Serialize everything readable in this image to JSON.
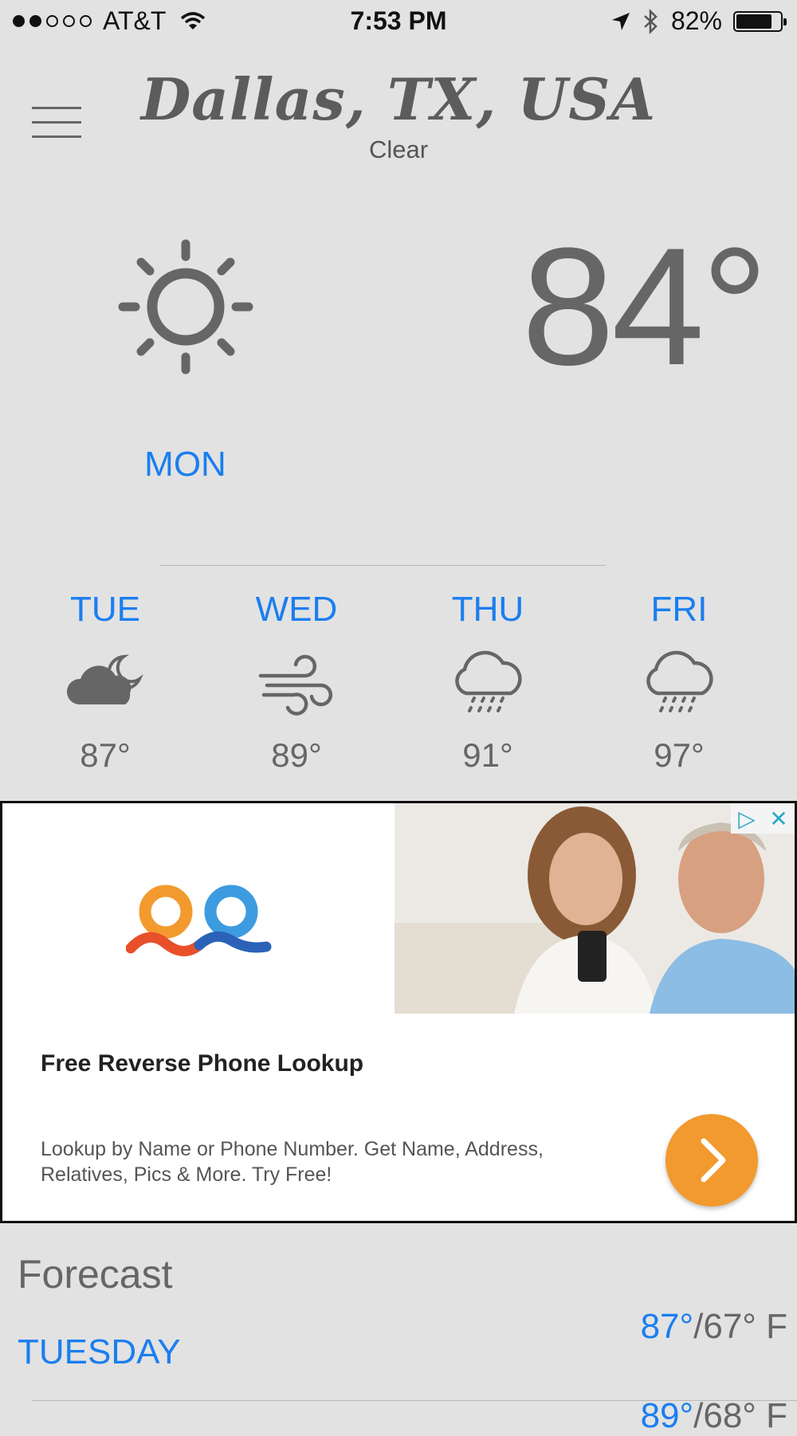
{
  "status_bar": {
    "signal_bars_filled": 2,
    "signal_bars_total": 5,
    "carrier": "AT&T",
    "time": "7:53 PM",
    "battery_text": "82%",
    "battery_level": 0.82,
    "icons": [
      "wifi-icon",
      "location-arrow-icon",
      "bluetooth-icon",
      "battery-icon"
    ]
  },
  "header": {
    "menu_icon": "hamburger-menu-icon",
    "location": "Dallas, TX, USA",
    "condition": "Clear"
  },
  "current": {
    "icon": "sun-icon",
    "temperature": "84°",
    "day": "MON"
  },
  "days": [
    {
      "name": "TUE",
      "icon": "cloudy-night-icon",
      "temp": "87°"
    },
    {
      "name": "WED",
      "icon": "wind-icon",
      "temp": "89°"
    },
    {
      "name": "THU",
      "icon": "rain-cloud-icon",
      "temp": "91°"
    },
    {
      "name": "FRI",
      "icon": "rain-cloud-icon",
      "temp": "97°"
    }
  ],
  "ad": {
    "title": "Free Reverse Phone Lookup",
    "description": "Lookup by Name or Phone Number. Get Name, Address, Relatives, Pics & More. Try Free!",
    "cta_icon": "chevron-right-icon",
    "adchoices_icon": "adchoices-icon",
    "close_icon": "close-icon",
    "colors": {
      "cta": "#f29a2e",
      "logo_orange": "#f29a2e",
      "logo_blue": "#3d9be0",
      "logo_red": "#e8502a",
      "logo_navy": "#2b62b8"
    }
  },
  "forecast": {
    "title": "Forecast",
    "rows": [
      {
        "day": "TUESDAY",
        "high": "87°",
        "low": "67° F"
      },
      {
        "day": "",
        "high": "89°",
        "low": "68° F"
      }
    ]
  },
  "colors": {
    "accent": "#1a7ef0",
    "background": "#e2e2e2",
    "text": "#666666"
  }
}
